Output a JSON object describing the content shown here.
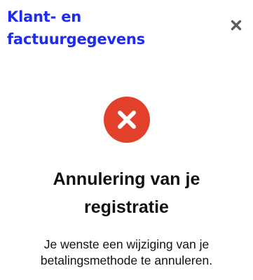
{
  "header": {
    "title_line1": "Klant- en",
    "title_line2": "factuurgegevens",
    "accent_color": "#1f2bef"
  },
  "close_button": {
    "icon": "close-icon"
  },
  "status": {
    "icon": "error-x-icon",
    "color": "#e2402a"
  },
  "message": {
    "heading_line1": "Annulering van je",
    "heading_line2": "registratie",
    "body_line1": "Je wenste een wijziging van je",
    "body_line2": "betalingsmethode te annuleren."
  }
}
